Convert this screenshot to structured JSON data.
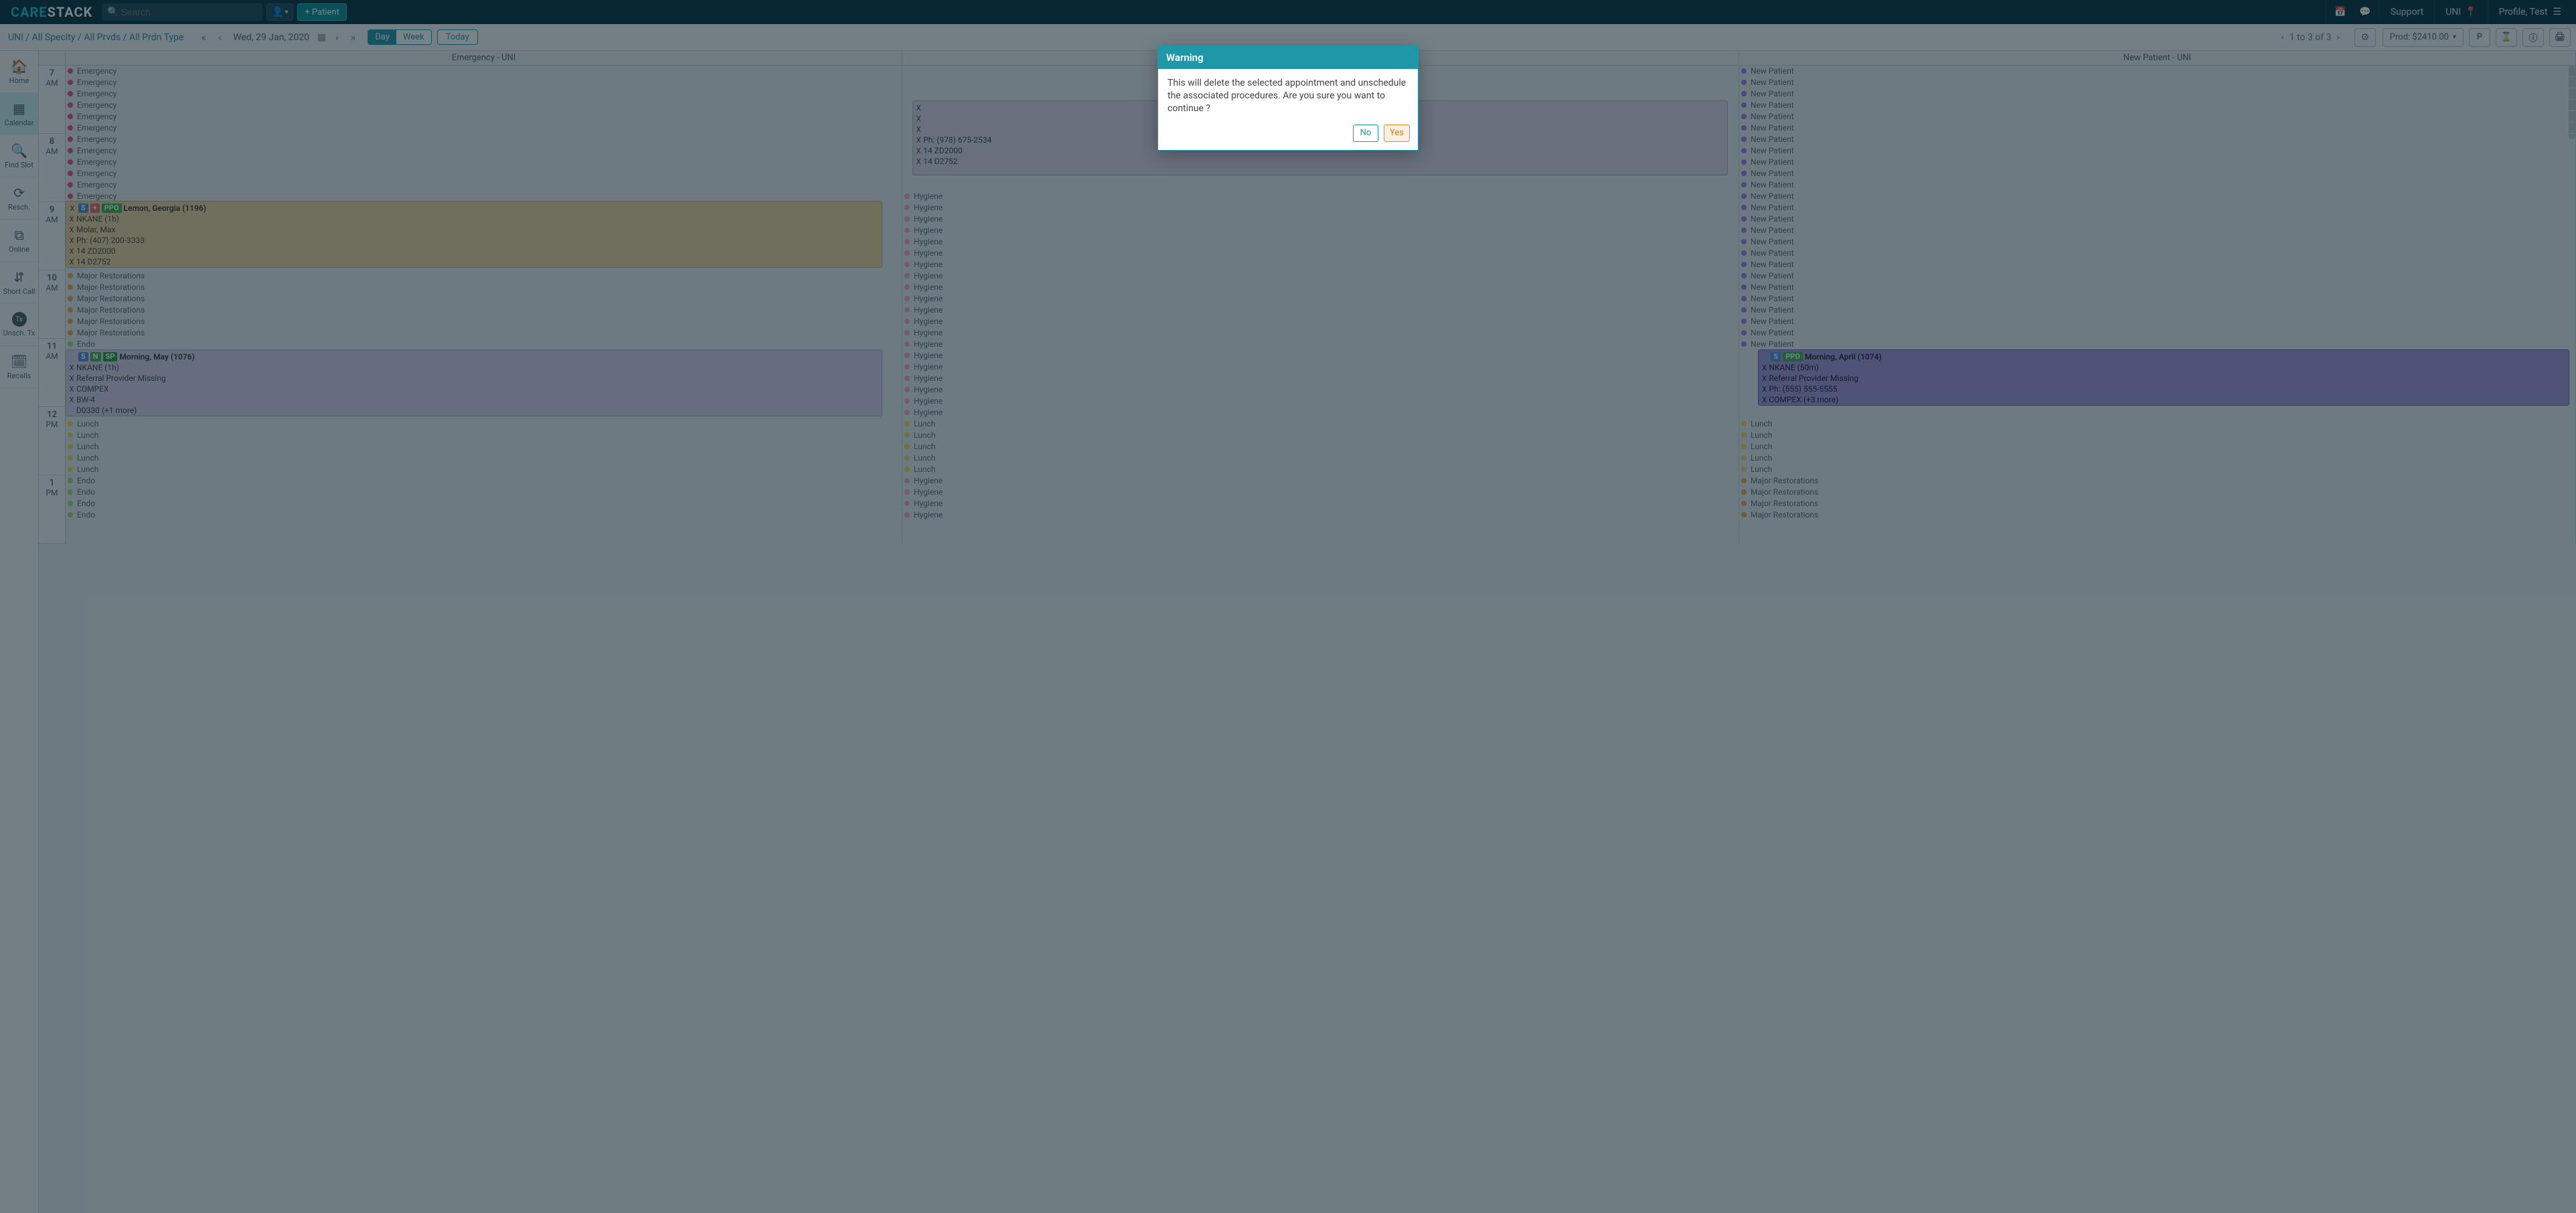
{
  "topbar": {
    "logo_a": "CARE",
    "logo_b": "STACK",
    "search_placeholder": "Search",
    "add_patient": "+ Patient",
    "support": "Support",
    "location": "UNI",
    "profile": "Profile, Test"
  },
  "subbar": {
    "crumbs": "UNI / All Speclty / All Prvds / All Prdn Type",
    "date": "Wed,  29 Jan, 2020",
    "day": "Day",
    "week": "Week",
    "today": "Today",
    "pager": "1 to 3 of 3",
    "prod": "Prod: $2410.00",
    "btn_p": "P"
  },
  "sidenav": {
    "home": "Home",
    "calendar": "Calendar",
    "find_slot": "Find Slot",
    "resch": "Resch.",
    "online": "Online",
    "short_call": "Short Call",
    "unsch_tx": "Unsch. Tx",
    "tx_lbl": "Tx",
    "recalls": "Recalls"
  },
  "columns": [
    "Emergency - UNI",
    "",
    "New Patient - UNI"
  ],
  "hours": [
    {
      "hr": "7",
      "mer": "AM"
    },
    {
      "hr": "8",
      "mer": "AM"
    },
    {
      "hr": "9",
      "mer": "AM"
    },
    {
      "hr": "10",
      "mer": "AM"
    },
    {
      "hr": "11",
      "mer": "AM"
    },
    {
      "hr": "12",
      "mer": "PM"
    },
    {
      "hr": "1",
      "mer": "PM"
    }
  ],
  "labels": {
    "emergency": "Emergency",
    "hygiene": "Hygiene",
    "new_patient": "New Patient",
    "major_rest": "Major Restorations",
    "lunch": "Lunch",
    "endo": "Endo"
  },
  "pill": {
    "s": "S",
    "plus": "+",
    "ppo": "PPO",
    "n": "N",
    "sp": "SP"
  },
  "appt1": {
    "title": "Lemon, Georgia (1196)",
    "l1": "NKANE (1h)",
    "l2": "Molar, Max",
    "l3": "Ph: (407) 200-3333",
    "l4": "14 ZD2000",
    "l5": "14 D2752"
  },
  "appt2": {
    "l1": "Ph: (978) 675-2534",
    "l2": "14 ZD2000",
    "l3": "14 D2752"
  },
  "appt3": {
    "title": "Morning, May (1076)",
    "l1": "NKANE (1h)",
    "l2": "Referral Provider Missing",
    "l3": "COMPEX",
    "l4": "BW-4",
    "l5": "D0330 (+1 more)"
  },
  "appt4": {
    "title": "Morning, April (1074)",
    "l1": "NKANE (50m)",
    "l2": "Referral Provider Missing",
    "l3": "Ph: (555) 555-5555",
    "l4": "COMPEX (+3 more)"
  },
  "modal": {
    "title": "Warning",
    "body": "This will delete the selected appointment and unschedule the associated procedures. Are you sure you want to continue ?",
    "no": "No",
    "yes": "Yes"
  }
}
